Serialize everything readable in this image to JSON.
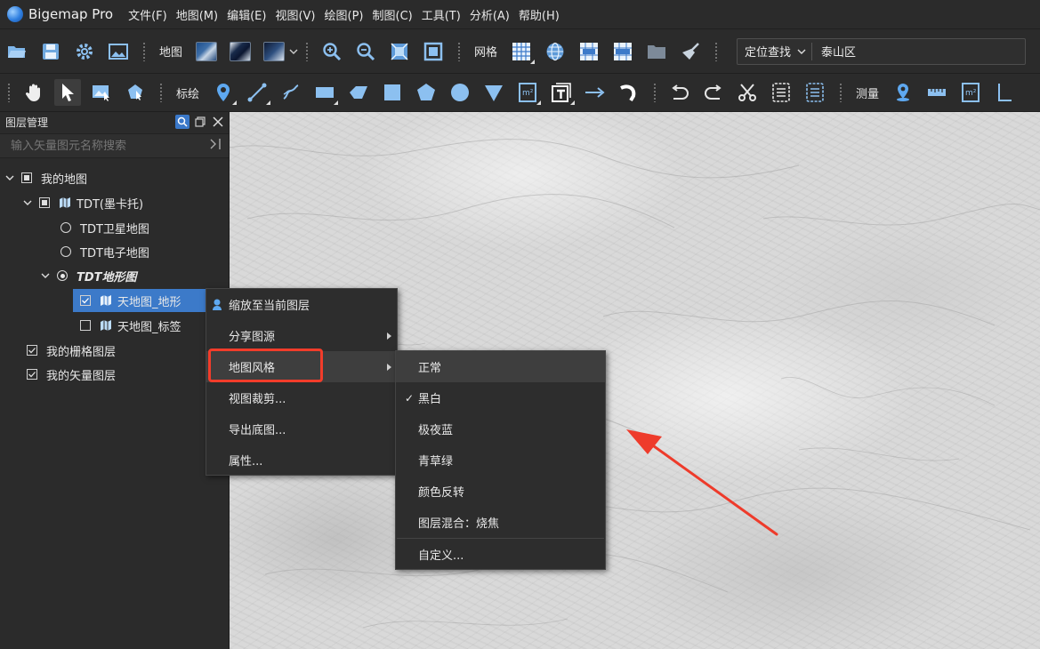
{
  "app": {
    "title": "Bigemap Pro"
  },
  "menubar": {
    "items": [
      "文件(F)",
      "地图(M)",
      "编辑(E)",
      "视图(V)",
      "绘图(P)",
      "制图(C)",
      "工具(T)",
      "分析(A)",
      "帮助(H)"
    ]
  },
  "toolbar1": {
    "map_label": "地图",
    "grid_label": "网格",
    "locate_select": "定位查找",
    "locate_value": "泰山区"
  },
  "toolbar2": {
    "draw_label": "标绘",
    "measure_label": "测量"
  },
  "layer_panel": {
    "title": "图层管理",
    "search_placeholder": "输入矢量图元名称搜索",
    "tree": {
      "my_map": "我的地图",
      "tdt_group": "TDT(墨卡托)",
      "tdt_satellite": "TDT卫星地图",
      "tdt_electronic": "TDT电子地图",
      "tdt_terrain": "TDT地形图",
      "tianditu_terrain": "天地图_地形",
      "tianditu_label": "天地图_标签",
      "my_raster": "我的栅格图层",
      "my_vector": "我的矢量图层"
    }
  },
  "context_menu": {
    "items": [
      "缩放至当前图层",
      "分享图源",
      "地图风格",
      "视图裁剪...",
      "导出底图...",
      "属性..."
    ]
  },
  "style_submenu": {
    "items": [
      "正常",
      "黑白",
      "极夜蓝",
      "青草绿",
      "颜色反转",
      "图层混合：烧焦",
      "自定义..."
    ],
    "checked": "黑白"
  },
  "colors": {
    "accent_blue": "#3c7ac9",
    "highlight_red": "#f23c2a",
    "panel_bg": "#2b2b2b"
  }
}
